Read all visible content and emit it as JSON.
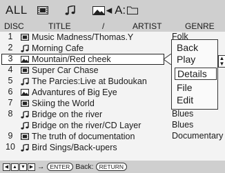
{
  "topbar": {
    "all_label": "ALL",
    "folder_label": "◂ A:",
    "icons": [
      "film-icon",
      "music-note-icon",
      "picture-icon",
      "folder-icon"
    ]
  },
  "header": {
    "disc": "DISC",
    "title": "TITLE",
    "slash": "/",
    "artist": "ARTIST",
    "genre": "GENRE"
  },
  "rows": [
    {
      "num": "1",
      "icon": "film",
      "title": "Music Madness/Thomas.Y",
      "genre": "Folk"
    },
    {
      "num": "2",
      "icon": "music",
      "title": "Morning Cafe",
      "genre": ""
    },
    {
      "num": "3",
      "icon": "picture",
      "title": "Mountain/Red cheek",
      "genre": ""
    },
    {
      "num": "4",
      "icon": "film",
      "title": "Super Car Chase",
      "genre": ""
    },
    {
      "num": "5",
      "icon": "music",
      "title": "The Parcies:Live at Budoukan",
      "genre": ""
    },
    {
      "num": "6",
      "icon": "picture",
      "title": "Advantures of Big Eye",
      "genre": ""
    },
    {
      "num": "7",
      "icon": "film",
      "title": "Skiing the World",
      "genre": ""
    },
    {
      "num": "8",
      "icon": "music",
      "title": "Bridge on the river",
      "genre": "Blues"
    },
    {
      "num": "",
      "icon": "music",
      "title": "Bridge on the river/CD Layer",
      "genre": "Blues"
    },
    {
      "num": "9",
      "icon": "film",
      "title": "The truth of documentation",
      "genre": "Documentary"
    },
    {
      "num": "10",
      "icon": "music",
      "title": "Bird Sings/Back-upers",
      "genre": ""
    }
  ],
  "popup": {
    "items": [
      "Back",
      "Play",
      "Details",
      "File",
      "Edit"
    ],
    "highlighted": "Details"
  },
  "footer": {
    "arrow_keys": [
      "◀",
      "▲",
      "▼",
      "▶"
    ],
    "arrow": "→",
    "enter": "ENTER",
    "back_text": "Back:",
    "return": "RETURN"
  }
}
